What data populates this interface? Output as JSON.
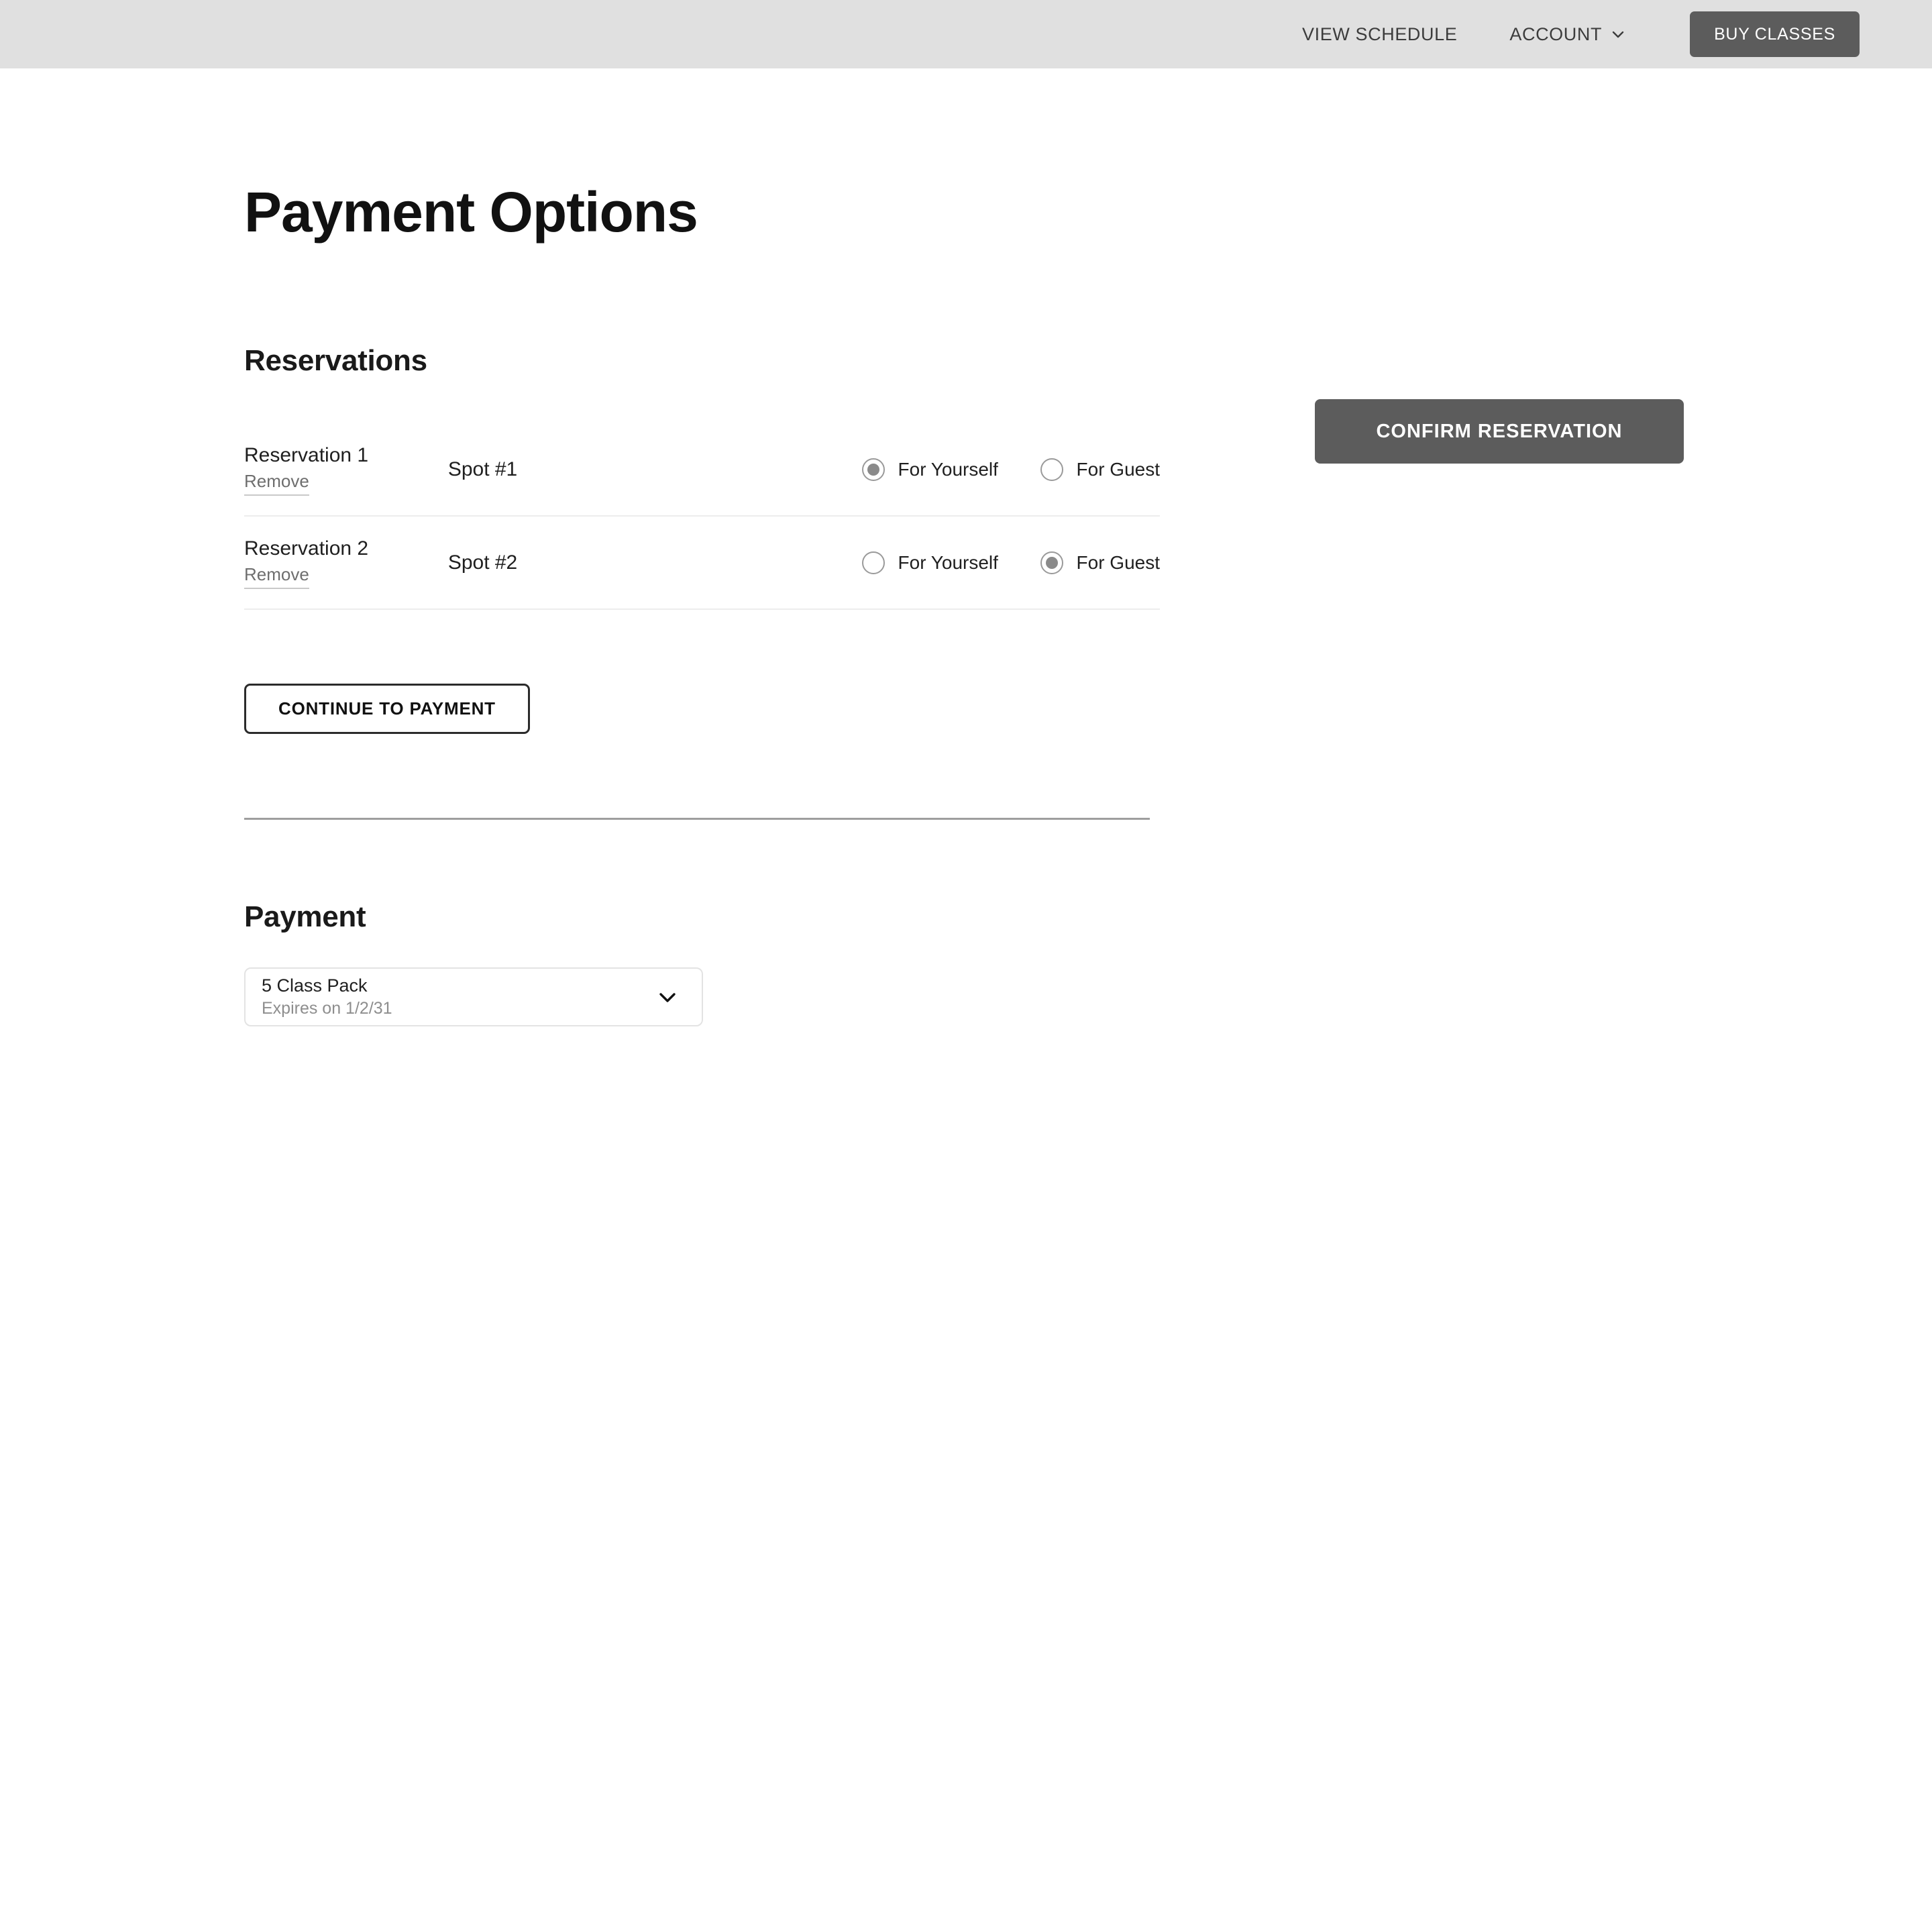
{
  "header": {
    "view_schedule_label": "VIEW SCHEDULE",
    "account_label": "ACCOUNT",
    "account_chevron_icon": "chevron-down-icon",
    "buy_classes_label": "BUY CLASSES",
    "background_color": "#e0e0e0",
    "button_color": "#5c5c5c"
  },
  "main": {
    "page_title": "Payment Options",
    "reservations": {
      "section_title": "Reservations",
      "rows": [
        {
          "name": "Reservation 1",
          "remove_label": "Remove",
          "spot": "Spot #1",
          "options": [
            {
              "label": "For Yourself",
              "selected": true
            },
            {
              "label": "For Guest",
              "selected": false
            }
          ]
        },
        {
          "name": "Reservation 2",
          "remove_label": "Remove",
          "spot": "Spot #2",
          "options": [
            {
              "label": "For Yourself",
              "selected": false
            },
            {
              "label": "For Guest",
              "selected": true
            }
          ]
        }
      ],
      "continue_label": "CONTINUE TO PAYMENT"
    },
    "payment": {
      "section_title": "Payment",
      "selected_pack": "5 Class Pack",
      "selected_expiry": "Expires on 1/2/31",
      "chevron_icon": "chevron-down-icon"
    }
  },
  "sidebar": {
    "confirm_label": "CONFIRM RESERVATION"
  }
}
